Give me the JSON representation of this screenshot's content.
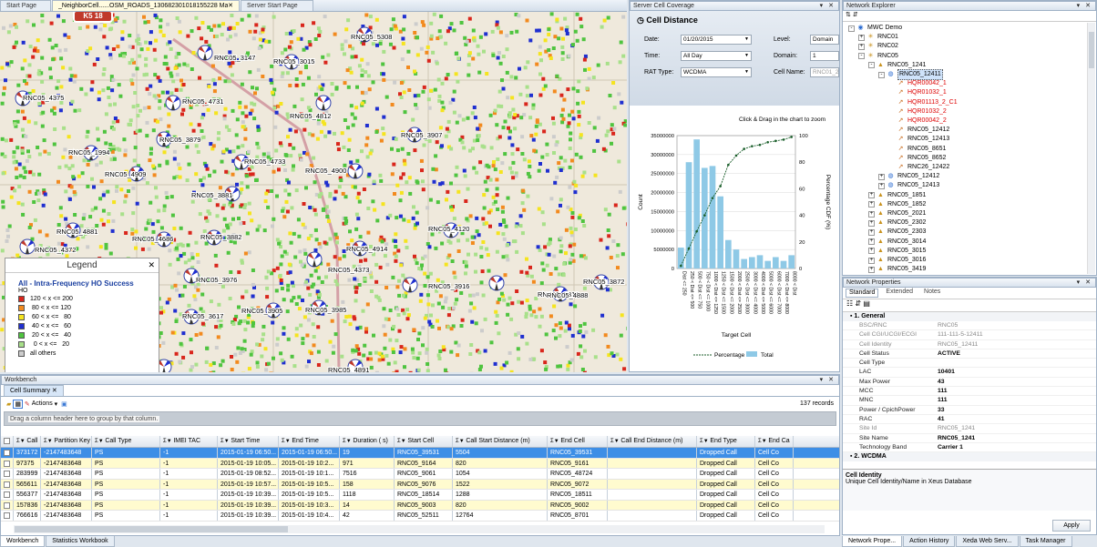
{
  "tabs": [
    {
      "label": "Start Page"
    },
    {
      "label": "_NeighborCell......OSM_ROADS_130682301018155228 Map"
    },
    {
      "label": "Server Start Page"
    }
  ],
  "map": {
    "road_shield": "K5 18",
    "labels": [
      "RNC05_5308",
      "RNC05_3147",
      "RNC05_3015",
      "RNC05_4375",
      "RNC05_4731",
      "RNC05_4812",
      "RNC05_3907",
      "RNC05_3879",
      "RNC05_1994",
      "RNC05_4733",
      "RNC05_4900",
      "RNC05_4909",
      "RNC05_3881",
      "RNC05_4881",
      "RNC05_4686",
      "RNC05_3882",
      "RNC05_4372",
      "RNC05_4120",
      "RNC05_4914",
      "RNC05_4373",
      "RNC05_3976",
      "RNC05_3916",
      "RNC05_5313",
      "RNC05_3872",
      "RNC05_4888",
      "RNC05_3905",
      "RNC05_3985",
      "RNC05_3617",
      "RNC05_4891"
    ]
  },
  "legend": {
    "title": "Legend",
    "heading": "All - Intra-Frequency HO Success",
    "subheading": "HO",
    "rows": [
      {
        "color": "#d9261c",
        "label": "120 < x <= 200"
      },
      {
        "color": "#f28a1e",
        "label": " 80 < x <= 120"
      },
      {
        "color": "#f5e41e",
        "label": " 60 < x <=   80"
      },
      {
        "color": "#1f2fd0",
        "label": " 40 < x <=   60"
      },
      {
        "color": "#4fc43f",
        "label": " 20 < x <=   40"
      },
      {
        "color": "#a8e08a",
        "label": "  0 < x <=   20"
      },
      {
        "color": "#cccccc",
        "label": "all others"
      }
    ]
  },
  "coverage": {
    "panel_title": "Server Cell Coverage",
    "title": "Cell Distance",
    "date_label": "Date:",
    "date_value": "01/20/2015",
    "time_label": "Time:",
    "time_value": "All Day",
    "rat_label": "RAT Type:",
    "rat_value": "WCDMA",
    "level_label": "Level:",
    "level_value": "Domain",
    "domain_label": "Domain:",
    "domain_value": "1",
    "cellname_label": "Cell Name:",
    "cellname_value": "RNC01_2",
    "zoom_hint": "Click & Drag in the chart to zoom"
  },
  "chart_data": {
    "type": "bar",
    "title": "",
    "xlabel": "Target Cell",
    "ylabel": "Count",
    "y2label": "Percentage CDF (%)",
    "categories": [
      "Dist <= 250",
      "250 < Dist <= 500",
      "500 < Dist <= 750",
      "750 < Dist <= 1000",
      "1000 < Dist <= 1250",
      "1250 < Dist <= 1500",
      "1500 < Dist <= 2000",
      "2000 < Dist <= 2500",
      "2500 < Dist <= 3000",
      "3000 < Dist <= 4000",
      "4000 < Dist <= 5000",
      "5000 < Dist <= 6000",
      "6000 < Dist <= 7000",
      "7000 < Dist <= 8000",
      "8000 < Dist"
    ],
    "series": [
      {
        "name": "Total",
        "type": "bar",
        "values": [
          5500000,
          28000000,
          34000000,
          26500000,
          27000000,
          19000000,
          7500000,
          5000000,
          2500000,
          3000000,
          3500000,
          2000000,
          3000000,
          2000000,
          3500000
        ]
      },
      {
        "name": "Percentage",
        "type": "line",
        "values": [
          2,
          15,
          28,
          40,
          53,
          62,
          78,
          85,
          90,
          92,
          93,
          95,
          96,
          97,
          99
        ]
      }
    ],
    "ylim": [
      0,
      35000000
    ],
    "y2lim": [
      0,
      100
    ],
    "yticks": [
      "0",
      "5000000",
      "10000000",
      "15000000",
      "20000000",
      "25000000",
      "30000000",
      "35000000"
    ],
    "y2ticks": [
      "0",
      "20",
      "40",
      "60",
      "80",
      "100"
    ],
    "legend": "bottom",
    "grid": true
  },
  "explorer": {
    "title": "Network Explorer",
    "nodes": [
      {
        "label": "MWC Demo",
        "level": 0,
        "exp": "-",
        "icon": "folder",
        "color": "#000"
      },
      {
        "label": "RNC01",
        "level": 1,
        "exp": "+",
        "icon": "rnc",
        "color": "#000"
      },
      {
        "label": "RNC02",
        "level": 1,
        "exp": "+",
        "icon": "rnc",
        "color": "#000"
      },
      {
        "label": "RNC05",
        "level": 1,
        "exp": "-",
        "icon": "rnc",
        "color": "#000"
      },
      {
        "label": "RNC05_1241",
        "level": 2,
        "exp": "-",
        "icon": "site",
        "color": "#000"
      },
      {
        "label": "RNC05_12411",
        "level": 3,
        "exp": "-",
        "icon": "cell",
        "color": "#000",
        "selected": true
      },
      {
        "label": "HQR00042_1",
        "level": 4,
        "exp": "",
        "icon": "nbr",
        "color": "#d00"
      },
      {
        "label": "HQR01032_1",
        "level": 4,
        "exp": "",
        "icon": "nbr",
        "color": "#d00"
      },
      {
        "label": "HQR01113_2_C1",
        "level": 4,
        "exp": "",
        "icon": "nbr",
        "color": "#d00"
      },
      {
        "label": "HQR01032_2",
        "level": 4,
        "exp": "",
        "icon": "nbr",
        "color": "#d00"
      },
      {
        "label": "HQR00042_2",
        "level": 4,
        "exp": "",
        "icon": "nbr",
        "color": "#d00"
      },
      {
        "label": "RNC05_12412",
        "level": 4,
        "exp": "",
        "icon": "nbr",
        "color": "#000"
      },
      {
        "label": "RNC05_12413",
        "level": 4,
        "exp": "",
        "icon": "nbr",
        "color": "#000"
      },
      {
        "label": "RNC05_8651",
        "level": 4,
        "exp": "",
        "icon": "nbr",
        "color": "#000"
      },
      {
        "label": "RNC05_8652",
        "level": 4,
        "exp": "",
        "icon": "nbr",
        "color": "#000"
      },
      {
        "label": "RNC26_12422",
        "level": 4,
        "exp": "",
        "icon": "nbr",
        "color": "#000"
      },
      {
        "label": "RNC05_12412",
        "level": 3,
        "exp": "+",
        "icon": "cell",
        "color": "#000"
      },
      {
        "label": "RNC05_12413",
        "level": 3,
        "exp": "+",
        "icon": "cell",
        "color": "#000"
      },
      {
        "label": "RNC05_1851",
        "level": 2,
        "exp": "+",
        "icon": "site",
        "color": "#000"
      },
      {
        "label": "RNC05_1852",
        "level": 2,
        "exp": "+",
        "icon": "site",
        "color": "#000"
      },
      {
        "label": "RNC05_2021",
        "level": 2,
        "exp": "+",
        "icon": "site",
        "color": "#000"
      },
      {
        "label": "RNC05_2302",
        "level": 2,
        "exp": "+",
        "icon": "site",
        "color": "#000"
      },
      {
        "label": "RNC05_2303",
        "level": 2,
        "exp": "+",
        "icon": "site",
        "color": "#000"
      },
      {
        "label": "RNC05_3014",
        "level": 2,
        "exp": "+",
        "icon": "site",
        "color": "#000"
      },
      {
        "label": "RNC05_3015",
        "level": 2,
        "exp": "+",
        "icon": "site",
        "color": "#000"
      },
      {
        "label": "RNC05_3016",
        "level": 2,
        "exp": "+",
        "icon": "site",
        "color": "#000"
      },
      {
        "label": "RNC05_3419",
        "level": 2,
        "exp": "+",
        "icon": "site",
        "color": "#000"
      }
    ]
  },
  "properties": {
    "title": "Network Properties",
    "tabs": [
      "Standard",
      "Extended",
      "Notes"
    ],
    "sections": [
      {
        "name": "1. General",
        "rows": [
          {
            "k": "BSC/RNC",
            "v": "RNC05",
            "ro": true
          },
          {
            "k": "Cell CGI/UCGI/ECGI",
            "v": "111-111-5-12411",
            "ro": true
          },
          {
            "k": "Cell Identity",
            "v": "RNC05_12411",
            "ro": true
          },
          {
            "k": "Cell Status",
            "v": "ACTIVE",
            "ro": false
          },
          {
            "k": "Cell Type",
            "v": "",
            "ro": false
          },
          {
            "k": "LAC",
            "v": "10401",
            "ro": false
          },
          {
            "k": "Max Power",
            "v": "43",
            "ro": false
          },
          {
            "k": "MCC",
            "v": "111",
            "ro": false
          },
          {
            "k": "MNC",
            "v": "111",
            "ro": false
          },
          {
            "k": "Power / CpichPower",
            "v": "33",
            "ro": false
          },
          {
            "k": "RAC",
            "v": "41",
            "ro": false
          },
          {
            "k": "Site Id",
            "v": "RNC05_1241",
            "ro": true
          },
          {
            "k": "Site Name",
            "v": "RNC05_1241",
            "ro": false
          },
          {
            "k": "Technology Band",
            "v": "Carrier 1",
            "ro": false
          }
        ]
      },
      {
        "name": "2. WCDMA",
        "rows": []
      }
    ],
    "desc_title": "Cell Identity",
    "desc_text": "Unique Cell Identity/Name in Xeus Database",
    "apply_label": "Apply"
  },
  "bottom_right_tabs": [
    "Network Prope...",
    "Action History",
    "Xeda Web Serv...",
    "Task Manager"
  ],
  "workbench": {
    "title": "Workbench",
    "tab": "Cell Summary",
    "actions_label": "Actions",
    "record_count": "137 records",
    "group_hint": "Drag a column header here to group by that column.",
    "columns": [
      "Call Id",
      "Partition Key",
      "Call Type",
      "IMEI TAC",
      "Start Time",
      "End Time",
      "Duration ( s)",
      "Start Cell",
      "Call Start Distance (m)",
      "End Cell",
      "Call End Distance (m)",
      "End Type",
      "End Ca"
    ],
    "rows": [
      [
        "373172",
        "-2147483648",
        "PS",
        "-1",
        "2015-01-19 06:50...",
        "2015-01-19 06:50...",
        "19",
        "RNC05_39531",
        "5504",
        "RNC05_39531",
        "",
        "Dropped Call",
        "Cell Co"
      ],
      [
        "97375",
        "-2147483648",
        "PS",
        "-1",
        "2015-01-19 10:05...",
        "2015-01-19 10:2...",
        "971",
        "RNC05_9164",
        "820",
        "RNC05_9161",
        "",
        "Dropped Call",
        "Cell Co"
      ],
      [
        "283999",
        "-2147483648",
        "PS",
        "-1",
        "2015-01-19 08:52...",
        "2015-01-19 10:1...",
        "7516",
        "RNC05_9061",
        "1054",
        "RNC05_48724",
        "",
        "Dropped Call",
        "Cell Co"
      ],
      [
        "565611",
        "-2147483648",
        "PS",
        "-1",
        "2015-01-19 10:57...",
        "2015-01-19 10:5...",
        "158",
        "RNC05_9076",
        "1522",
        "RNC05_9072",
        "",
        "Dropped Call",
        "Cell Co"
      ],
      [
        "556377",
        "-2147483648",
        "PS",
        "-1",
        "2015-01-19 10:39...",
        "2015-01-19 10:5...",
        "1118",
        "RNC05_18514",
        "1288",
        "RNC05_18511",
        "",
        "Dropped Call",
        "Cell Co"
      ],
      [
        "157836",
        "-2147483648",
        "PS",
        "-1",
        "2015-01-19 10:39...",
        "2015-01-19 10:3...",
        "14",
        "RNC05_9003",
        "820",
        "RNC05_9002",
        "",
        "Dropped Call",
        "Cell Co"
      ],
      [
        "766616",
        "-2147483648",
        "PS",
        "-1",
        "2015-01-19 10:39...",
        "2015-01-19 10:4...",
        "42",
        "RNC05_52511",
        "12764",
        "RNC05_8701",
        "",
        "Dropped Call",
        "Cell Co"
      ]
    ],
    "bottom_tabs": [
      "Workbench",
      "Statistics Workbook"
    ]
  }
}
